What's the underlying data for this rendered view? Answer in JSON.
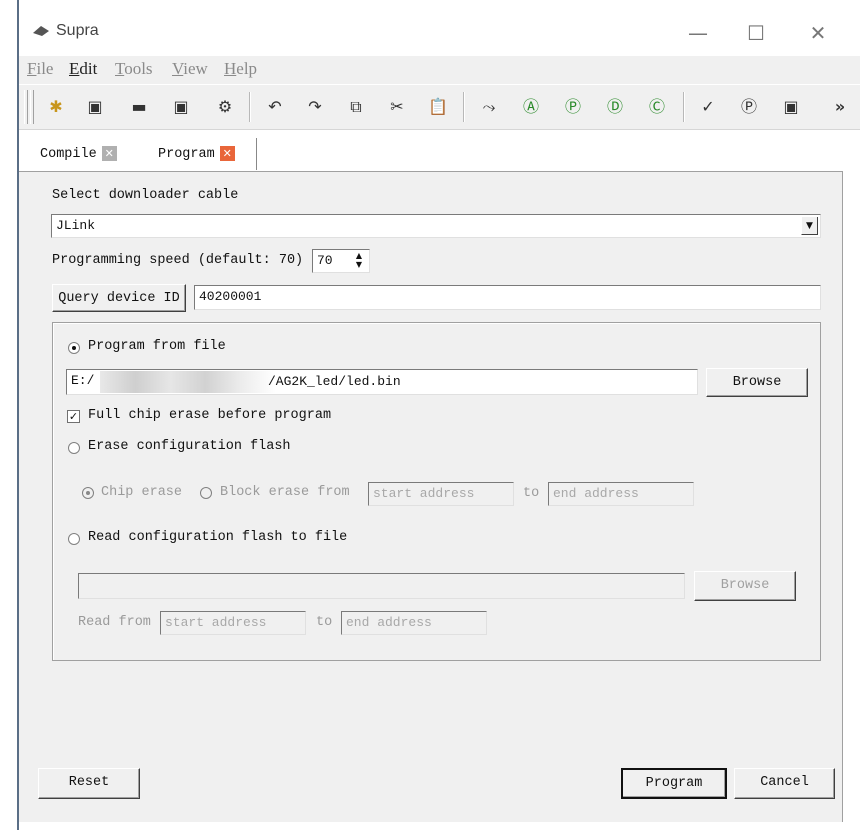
{
  "window": {
    "title": "Supra",
    "minimize": "—",
    "maximize": "☐",
    "close": "✕"
  },
  "menu": [
    "File",
    "Edit",
    "Tools",
    "View",
    "Help"
  ],
  "toolbar": {
    "icons": [
      "new-file-icon",
      "open-icon",
      "save-icon",
      "save-all-icon",
      "settings-icon",
      "undo-icon",
      "redo-icon",
      "copy-icon",
      "cut-icon",
      "paste-icon",
      "compile-icon",
      "run-a-icon",
      "run-p-icon",
      "run-d-icon",
      "run-c-icon",
      "check-icon",
      "program-icon",
      "device-icon"
    ],
    "glyphs": [
      "✱",
      "▣",
      "▬",
      "▣",
      "⚙",
      "↶",
      "↷",
      "⧉",
      "✂",
      "📋",
      "⤳",
      "Ⓐ",
      "Ⓟ",
      "Ⓓ",
      "Ⓒ",
      "✓",
      "Ⓟ",
      "▣"
    ],
    "overflow": "»"
  },
  "tabs": [
    {
      "label": "Compile",
      "close": "✕"
    },
    {
      "label": "Program",
      "close": "✕"
    }
  ],
  "form": {
    "cable_label": "Select downloader cable",
    "cable_value": "JLink",
    "speed_label": "Programming speed (default: 70)",
    "speed_value": "70",
    "query_button": "Query device ID",
    "device_id": "40200001",
    "program_from_file": "Program from file",
    "file_path_prefix": "E:/",
    "file_path_suffix": "/AG2K_led/led.bin",
    "browse_button": "Browse",
    "full_chip_erase": "Full chip erase before program",
    "erase_config_flash": "Erase configuration flash",
    "chip_erase": "Chip erase",
    "block_erase_from": "Block erase from",
    "start_address_placeholder": "start address",
    "to": "to",
    "end_address_placeholder": "end address",
    "read_config_flash": "Read configuration flash to file",
    "read_browse_button": "Browse",
    "read_from": "Read from",
    "read_start_placeholder": "start address",
    "read_to": "to",
    "read_end_placeholder": "end address"
  },
  "footer": {
    "reset": "Reset",
    "program": "Program",
    "cancel": "Cancel"
  },
  "colors": {
    "tab_close_inactive": "#b0b0b0",
    "tab_close_active": "#e9663a",
    "panel_bg": "#f0f0f0"
  }
}
